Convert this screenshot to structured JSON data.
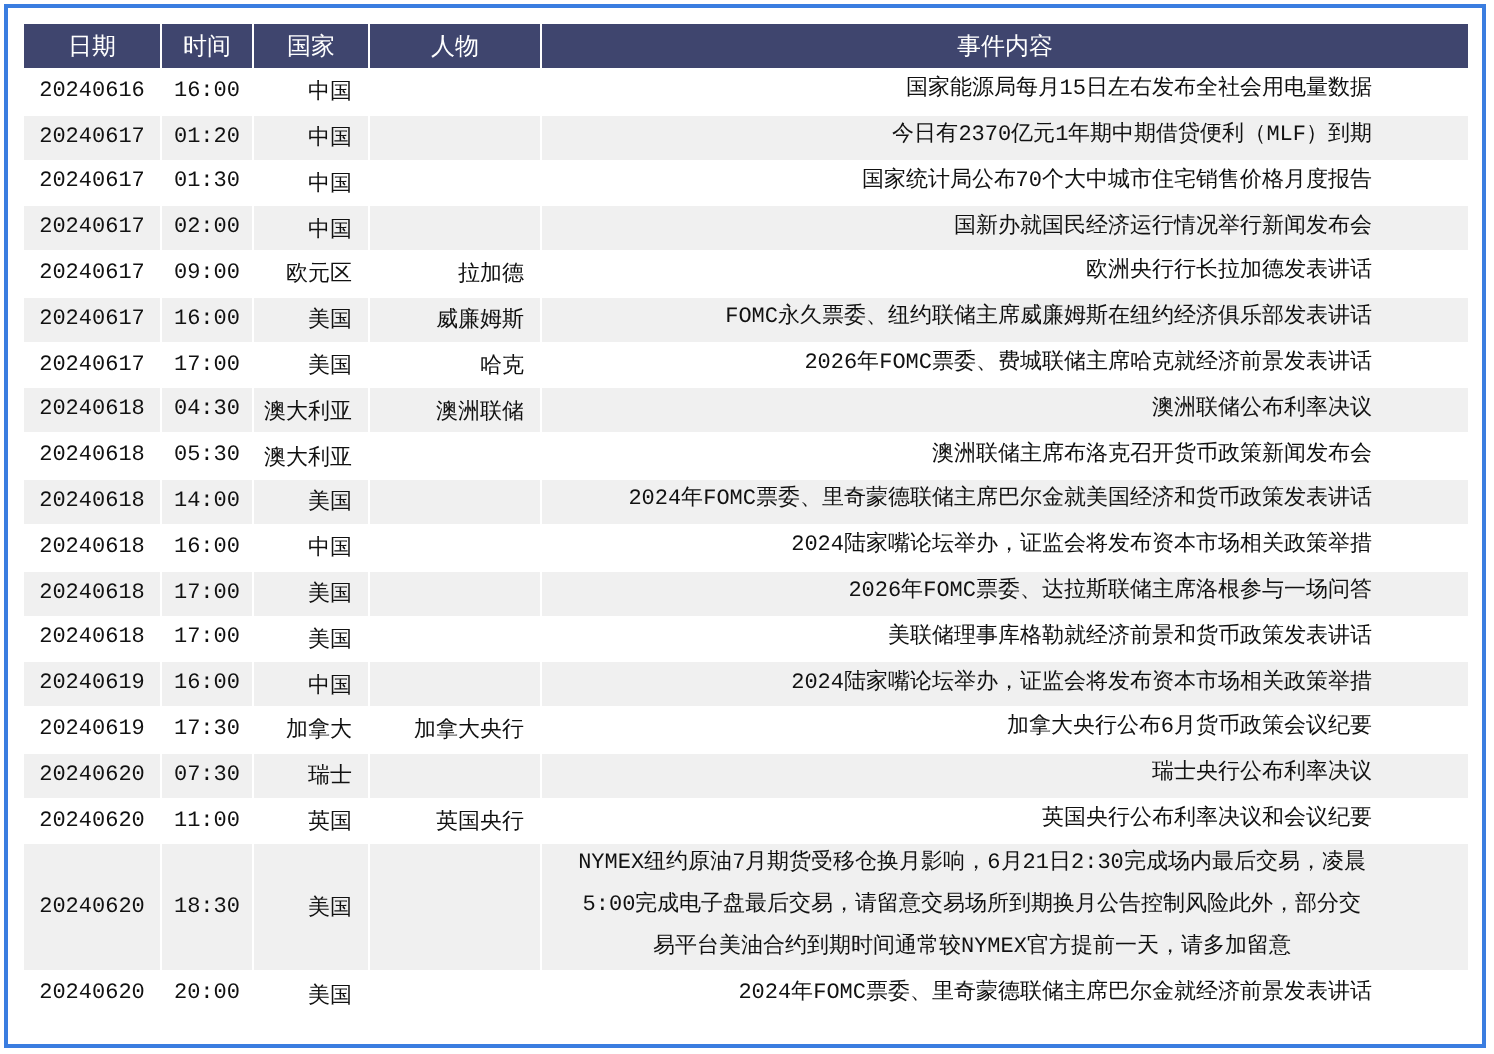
{
  "table": {
    "columns": [
      "日期",
      "时间",
      "国家",
      "人物",
      "事件内容"
    ],
    "rows": [
      {
        "date": "20240616",
        "time": "16:00",
        "country": "中国",
        "event": "国家能源局每月15日左右发布全社会用电量数据"
      },
      {
        "date": "20240617",
        "time": "01:20",
        "country": "中国",
        "event": "今日有2370亿元1年期中期借贷便利（MLF）到期"
      },
      {
        "date": "20240617",
        "time": "01:30",
        "country": "中国",
        "event": "国家统计局公布70个大中城市住宅销售价格月度报告"
      },
      {
        "date": "20240617",
        "time": "02:00",
        "country": "中国",
        "event": "国新办就国民经济运行情况举行新闻发布会"
      },
      {
        "date": "20240617",
        "time": "09:00",
        "country": "欧元区",
        "person": "拉加德",
        "event": "欧洲央行行长拉加德发表讲话"
      },
      {
        "date": "20240617",
        "time": "16:00",
        "country": "美国",
        "person": "威廉姆斯",
        "event": "FOMC永久票委、纽约联储主席威廉姆斯在纽约经济俱乐部发表讲话"
      },
      {
        "date": "20240617",
        "time": "17:00",
        "country": "美国",
        "person": "哈克",
        "event": "2026年FOMC票委、费城联储主席哈克就经济前景发表讲话"
      },
      {
        "date": "20240618",
        "time": "04:30",
        "country": "澳大利亚",
        "person": "澳洲联储",
        "event": "澳洲联储公布利率决议"
      },
      {
        "date": "20240618",
        "time": "05:30",
        "country": "澳大利亚",
        "event": "澳洲联储主席布洛克召开货币政策新闻发布会"
      },
      {
        "date": "20240618",
        "time": "14:00",
        "country": "美国",
        "event": "2024年FOMC票委、里奇蒙德联储主席巴尔金就美国经济和货币政策发表讲话"
      },
      {
        "date": "20240618",
        "time": "16:00",
        "country": "中国",
        "event": "2024陆家嘴论坛举办，证监会将发布资本市场相关政策举措"
      },
      {
        "date": "20240618",
        "time": "17:00",
        "country": "美国",
        "event": "2026年FOMC票委、达拉斯联储主席洛根参与一场问答"
      },
      {
        "date": "20240618",
        "time": "17:00",
        "country": "美国",
        "event": "美联储理事库格勒就经济前景和货币政策发表讲话"
      },
      {
        "date": "20240619",
        "time": "16:00",
        "country": "中国",
        "event": "2024陆家嘴论坛举办，证监会将发布资本市场相关政策举措"
      },
      {
        "date": "20240619",
        "time": "17:30",
        "country": "加拿大",
        "person": "加拿大央行",
        "event": "加拿大央行公布6月货币政策会议纪要"
      },
      {
        "date": "20240620",
        "time": "07:30",
        "country": "瑞士",
        "event": "瑞士央行公布利率决议"
      },
      {
        "date": "20240620",
        "time": "11:00",
        "country": "英国",
        "person": "英国央行",
        "event": "英国央行公布利率决议和会议纪要"
      },
      {
        "date": "20240620",
        "time": "18:30",
        "country": "美国",
        "event": "NYMEX纽约原油7月期货受移仓换月影响，6月21日2:30完成场内最后交易，凌晨5:00完成电子盘最后交易，请留意交易场所到期换月公告控制风险此外，部分交易平台美油合约到期时间通常较NYMEX官方提前一天，请多加留意"
      },
      {
        "date": "20240620",
        "time": "20:00",
        "country": "美国",
        "event": "2024年FOMC票委、里奇蒙德联储主席巴尔金就经济前景发表讲话"
      }
    ]
  }
}
